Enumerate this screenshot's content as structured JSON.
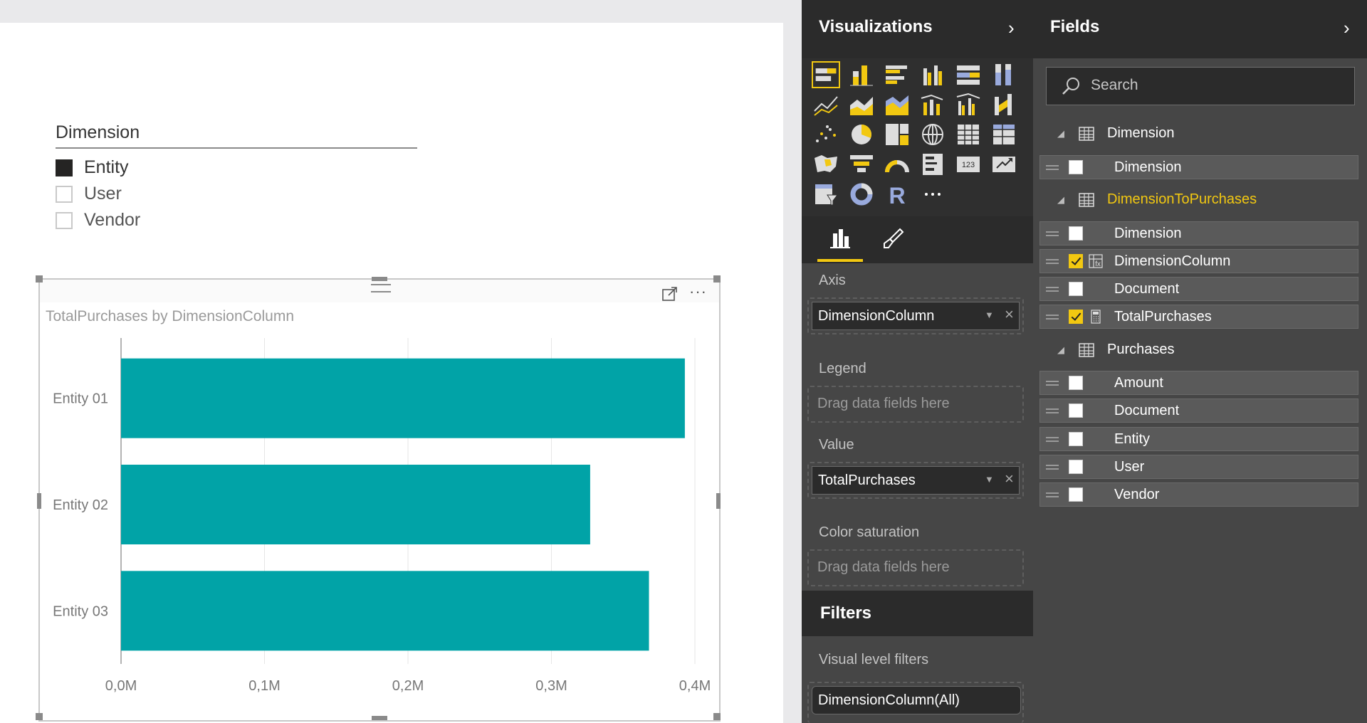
{
  "slicer": {
    "title": "Dimension",
    "items": [
      {
        "label": "Entity",
        "selected": true
      },
      {
        "label": "User",
        "selected": false
      },
      {
        "label": "Vendor",
        "selected": false
      }
    ]
  },
  "visual": {
    "more_glyph": "···"
  },
  "chart_data": {
    "type": "bar",
    "orientation": "horizontal",
    "title": "TotalPurchases by DimensionColumn",
    "categories": [
      "Entity 01",
      "Entity 02",
      "Entity 03"
    ],
    "values": [
      393000,
      327000,
      368000
    ],
    "xlim": [
      0,
      400000
    ],
    "x_ticks": [
      "0,0M",
      "0,1M",
      "0,2M",
      "0,3M",
      "0,4M"
    ],
    "grid": true,
    "bar_color": "#01a3a7"
  },
  "visualizations": {
    "title": "Visualizations",
    "chevron": "›",
    "wells": {
      "axis": {
        "label": "Axis",
        "field": "DimensionColumn"
      },
      "legend": {
        "label": "Legend",
        "placeholder": "Drag data fields here"
      },
      "value": {
        "label": "Value",
        "field": "TotalPurchases"
      },
      "color_saturation": {
        "label": "Color saturation",
        "placeholder": "Drag data fields here"
      }
    },
    "filters": {
      "title": "Filters",
      "visual_level_label": "Visual level filters",
      "visual_level_filter": "DimensionColumn(All)"
    }
  },
  "fields": {
    "title": "Fields",
    "chevron": "›",
    "search_placeholder": "Search",
    "tables": [
      {
        "name": "Dimension",
        "fields": [
          {
            "name": "Dimension",
            "checked": false
          }
        ]
      },
      {
        "name": "DimensionToPurchases",
        "active": true,
        "fields": [
          {
            "name": "Dimension",
            "checked": false
          },
          {
            "name": "DimensionColumn",
            "checked": true,
            "icon": "calculated-column-icon"
          },
          {
            "name": "Document",
            "checked": false
          },
          {
            "name": "TotalPurchases",
            "checked": true,
            "icon": "calculator-icon"
          }
        ]
      },
      {
        "name": "Purchases",
        "fields": [
          {
            "name": "Amount",
            "checked": false
          },
          {
            "name": "Document",
            "checked": false
          },
          {
            "name": "Entity",
            "checked": false
          },
          {
            "name": "User",
            "checked": false
          },
          {
            "name": "Vendor",
            "checked": false
          }
        ]
      }
    ]
  },
  "colors": {
    "accent": "#f2c811",
    "bar": "#01a3a7",
    "pane_bg": "#464646",
    "pane_header": "#2b2b2b"
  }
}
